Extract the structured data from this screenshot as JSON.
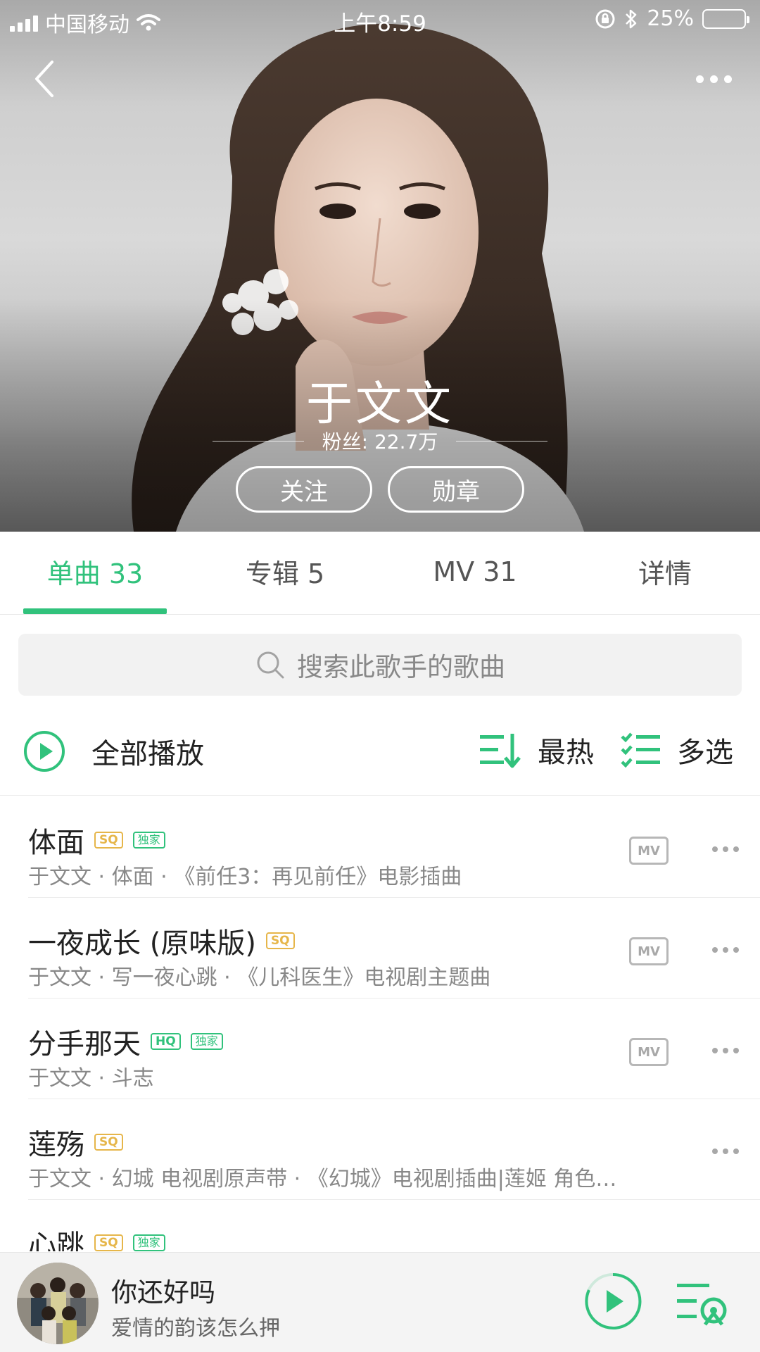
{
  "status_bar": {
    "carrier": "中国移动",
    "time": "上午8:59",
    "battery": "25%",
    "battery_level": 0.25,
    "icons": [
      "signal-icon",
      "wifi-icon",
      "orientation-lock-icon",
      "bluetooth-icon",
      "battery-icon"
    ]
  },
  "header": {
    "back_icon": "back-chevron-icon",
    "more_icon": "more-dots-icon",
    "artist_name": "于文文",
    "fans": "粉丝: 22.7万",
    "follow_label": "关注",
    "medal_label": "勋章"
  },
  "tabs": [
    {
      "label": "单曲 33",
      "active": true
    },
    {
      "label": "专辑 5",
      "active": false
    },
    {
      "label": "MV 31",
      "active": false
    },
    {
      "label": "详情",
      "active": false
    }
  ],
  "search": {
    "placeholder": "搜索此歌手的歌曲",
    "icon": "search-icon"
  },
  "actions": {
    "play_all": "全部播放",
    "sort": "最热",
    "multi_select": "多选"
  },
  "songs": [
    {
      "title": "体面",
      "badges": [
        "SQ",
        "独家"
      ],
      "subtitle": "于文文 · 体面 · 《前任3：再见前任》电影插曲",
      "has_mv": true
    },
    {
      "title": "一夜成长 (原味版)",
      "badges": [
        "SQ"
      ],
      "subtitle": "于文文 · 写一夜心跳 · 《儿科医生》电视剧主题曲",
      "has_mv": true
    },
    {
      "title": "分手那天",
      "badges": [
        "HQ",
        "独家"
      ],
      "subtitle": "于文文 · 斗志",
      "has_mv": true
    },
    {
      "title": "莲殇",
      "badges": [
        "SQ"
      ],
      "subtitle": "于文文 · 幻城 电视剧原声带 · 《幻城》电视剧插曲|莲姬 角色…",
      "has_mv": false
    },
    {
      "title": "心跳",
      "badges": [
        "SQ",
        "独家"
      ],
      "subtitle": "",
      "has_mv": false
    }
  ],
  "mv_label": "MV",
  "player": {
    "title": "你还好吗",
    "subtitle": "爱情的韵该怎么押"
  },
  "colors": {
    "accent": "#31c27c",
    "sq_badge": "#e6b64a",
    "text_primary": "#222222",
    "text_secondary": "#888888"
  }
}
